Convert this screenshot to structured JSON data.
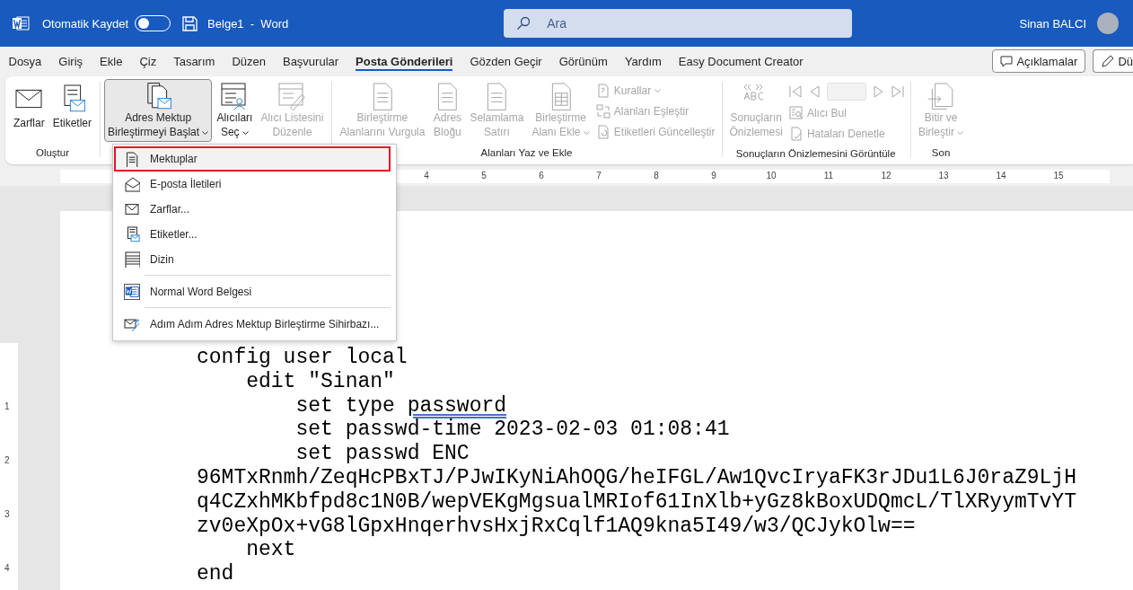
{
  "titlebar": {
    "autosave_label": "Otomatik Kaydet",
    "autosave_on": false,
    "document_title": "Belge1  -  Word",
    "search": {
      "placeholder": "Ara"
    },
    "user_name": "Sinan BALCI"
  },
  "tabs": [
    {
      "label": "Dosya",
      "selected": false
    },
    {
      "label": "Giriş",
      "selected": false
    },
    {
      "label": "Ekle",
      "selected": false
    },
    {
      "label": "Çiz",
      "selected": false
    },
    {
      "label": "Tasarım",
      "selected": false
    },
    {
      "label": "Düzen",
      "selected": false
    },
    {
      "label": "Başvurular",
      "selected": false
    },
    {
      "label": "Posta Gönderileri",
      "selected": true
    },
    {
      "label": "Gözden Geçir",
      "selected": false
    },
    {
      "label": "Görünüm",
      "selected": false
    },
    {
      "label": "Yardım",
      "selected": false
    },
    {
      "label": "Easy Document Creator",
      "selected": false
    }
  ],
  "actions": [
    {
      "kind": "comments",
      "label": "Açıklamalar"
    },
    {
      "kind": "edit",
      "label": "Dü"
    }
  ],
  "ribbon": {
    "groups": [
      {
        "label": "Oluştur",
        "items": [
          {
            "kind": "envelope",
            "label": "Zarflar",
            "disabled": false,
            "pressed": false,
            "dropdown": false
          },
          {
            "kind": "labels",
            "label": "Etiketler",
            "disabled": false,
            "pressed": false,
            "dropdown": false
          }
        ]
      },
      {
        "items": [
          {
            "kind": "merge",
            "label": "Adres Mektup\nBirleştirmeyi Başlat",
            "disabled": false,
            "pressed": true,
            "dropdown": true
          },
          {
            "kind": "recipients",
            "label": "Alıcıları\nSeç",
            "disabled": false,
            "pressed": false,
            "dropdown": true
          },
          {
            "kind": "editlist",
            "label": "Alıcı Listesini\nDüzenle",
            "disabled": true,
            "pressed": false,
            "dropdown": false
          }
        ]
      },
      {
        "label": "Alanları Yaz ve Ekle",
        "items": [
          {
            "kind": "doc",
            "label": "Birleştirme\nAlanlarını Vurgula",
            "disabled": true,
            "pressed": false,
            "dropdown": false
          },
          {
            "kind": "doc",
            "label": "Adres\nBloğu",
            "disabled": true,
            "pressed": false,
            "dropdown": false
          },
          {
            "kind": "doc",
            "label": "Selamlama\nSatırı",
            "disabled": true,
            "pressed": false,
            "dropdown": false
          },
          {
            "kind": "table",
            "label": "Birleştirme\nAlanı Ekle",
            "disabled": true,
            "pressed": false,
            "dropdown": true
          },
          {
            "kind": "stack",
            "items": [
              {
                "kind": "rules",
                "label": "Kurallar",
                "disabled": true,
                "dropdown": true
              },
              {
                "kind": "match",
                "label": "Alanları Eşleştir",
                "disabled": true,
                "dropdown": false
              },
              {
                "kind": "update",
                "label": "Etiketleri Güncelleştir",
                "disabled": true,
                "dropdown": false
              }
            ]
          }
        ]
      },
      {
        "label": "Sonuçların Önizlemesini Görüntüle",
        "items": [
          {
            "kind": "abc",
            "label": "Sonuçların\nÖnizlemesi",
            "disabled": true,
            "pressed": false,
            "dropdown": false
          },
          {
            "kind": "stack",
            "items": [
              {
                "kind": "nav",
                "disabled": true
              },
              {
                "kind": "find",
                "label": "Alıcı Bul",
                "disabled": true,
                "dropdown": false
              },
              {
                "kind": "check",
                "label": "Hataları Denetle",
                "disabled": true,
                "dropdown": false
              }
            ]
          }
        ]
      },
      {
        "label": "Son",
        "items": [
          {
            "kind": "finish",
            "label": "Bitir ve\nBirleştir",
            "disabled": true,
            "pressed": false,
            "dropdown": true
          }
        ]
      }
    ]
  },
  "ruler": {
    "horizontal": [
      "4",
      "5",
      "6",
      "7",
      "8",
      "9",
      "10",
      "11",
      "12",
      "13",
      "14",
      "15"
    ],
    "vertical": [
      "1",
      "2",
      "3",
      "4"
    ]
  },
  "menu": {
    "items": [
      {
        "kind": "doc",
        "label": "Mektuplar",
        "selected": true
      },
      {
        "kind": "email",
        "label": "E-posta İletileri",
        "selected": false
      },
      {
        "kind": "envelope",
        "label": "Zarflar...",
        "selected": false
      },
      {
        "kind": "labels",
        "label": "Etiketler...",
        "selected": false
      },
      {
        "kind": "directory",
        "label": "Dizin",
        "selected": false
      },
      {
        "kind": "separator"
      },
      {
        "kind": "word",
        "label": "Normal Word Belgesi",
        "selected": false
      },
      {
        "kind": "separator"
      },
      {
        "kind": "wizard",
        "label": "Adım Adım Adres Mektup Birleştirme Sihirbazı...",
        "selected": false
      }
    ]
  },
  "document": {
    "lines": [
      [
        {
          "text": "config user local",
          "flagged": false
        }
      ],
      [
        {
          "text": "    edit \"Sinan\"",
          "flagged": false
        }
      ],
      [
        {
          "text": "        set type ",
          "flagged": false
        },
        {
          "text": "password",
          "flagged": true
        }
      ],
      [
        {
          "text": "        set passwd-time 2023-02-03 01:08:41",
          "flagged": false
        }
      ],
      [
        {
          "text": "        set passwd ENC",
          "flagged": false
        }
      ],
      [
        {
          "text": "96MTxRnmh/ZeqHcPBxTJ/PJwIKyNiAhOQG/heIFGL/Aw1QvcIryaFK3rJDu1L6J0raZ9LjH",
          "flagged": false
        }
      ],
      [
        {
          "text": "q4CZxhMKbfpd8c1N0B/wepVEKgMgsualMRIof61InXlb+yGz8kBoxUDQmcL/TlXRyymTvYT",
          "flagged": false
        }
      ],
      [
        {
          "text": "zv0eXpOx+vG8lGpxHnqerhvsHxjRxCqlf1AQ9kna5I49/w3/QCJykOlw==",
          "flagged": false
        }
      ],
      [
        {
          "text": "    next",
          "flagged": false
        }
      ],
      [
        {
          "text": "end",
          "flagged": false
        }
      ]
    ]
  }
}
